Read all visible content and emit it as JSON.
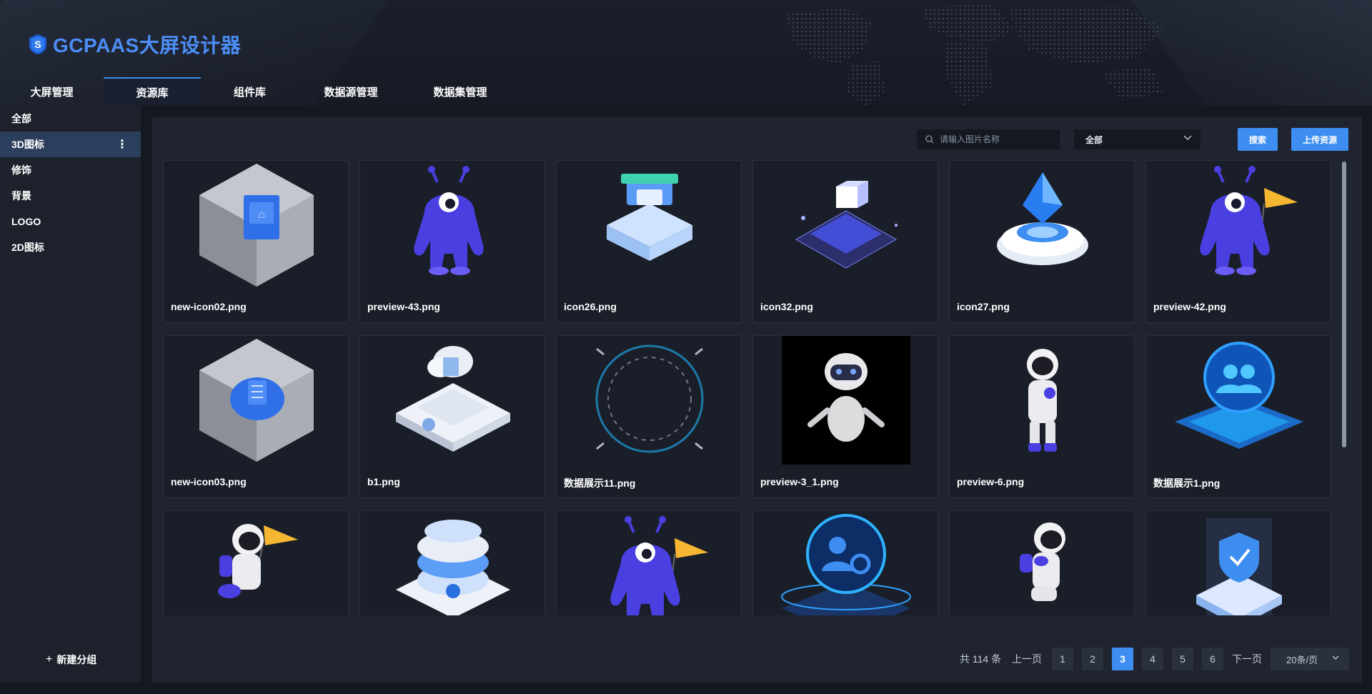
{
  "app": {
    "title": "GCPAAS大屏设计器"
  },
  "nav": {
    "tabs": [
      {
        "label": "大屏管理"
      },
      {
        "label": "资源库"
      },
      {
        "label": "组件库"
      },
      {
        "label": "数据源管理"
      },
      {
        "label": "数据集管理"
      }
    ],
    "active_tab": "资源库"
  },
  "sidebar": {
    "items": [
      {
        "label": "全部"
      },
      {
        "label": "3D图标"
      },
      {
        "label": "修饰"
      },
      {
        "label": "背景"
      },
      {
        "label": "LOGO"
      },
      {
        "label": "2D图标"
      }
    ],
    "active_item": "3D图标",
    "more_icon": "more-vertical-icon",
    "new_group_label": "新建分组"
  },
  "toolbar": {
    "search_placeholder": "请输入图片名称",
    "search_value": "",
    "type_select_value": "全部",
    "search_button_label": "搜索",
    "upload_button_label": "上传资源"
  },
  "resources": [
    {
      "name": "new-icon02.png",
      "icon": "3d-glass-cube-building-icon"
    },
    {
      "name": "preview-43.png",
      "icon": "purple-alien-mascot-icon"
    },
    {
      "name": "icon26.png",
      "icon": "3d-shop-store-icon"
    },
    {
      "name": "icon32.png",
      "icon": "3d-platform-cube-icon"
    },
    {
      "name": "icon27.png",
      "icon": "3d-crystal-pedestal-icon"
    },
    {
      "name": "preview-42.png",
      "icon": "purple-alien-flag-icon"
    },
    {
      "name": "new-icon03.png",
      "icon": "3d-glass-cube-cloud-icon"
    },
    {
      "name": "b1.png",
      "icon": "3d-cloud-server-icon"
    },
    {
      "name": "数据展示11.png",
      "icon": "glowing-ring-frame-icon"
    },
    {
      "name": "preview-3_1.png",
      "icon": "white-robot-icon"
    },
    {
      "name": "preview-6.png",
      "icon": "astronaut-standing-icon"
    },
    {
      "name": "数据展示1.png",
      "icon": "users-hologram-platform-icon"
    },
    {
      "name": "",
      "icon": "astronaut-flag-icon"
    },
    {
      "name": "",
      "icon": "3d-database-stack-icon"
    },
    {
      "name": "",
      "icon": "purple-alien-flag-icon"
    },
    {
      "name": "",
      "icon": "user-settings-hologram-icon"
    },
    {
      "name": "",
      "icon": "astronaut-kneeling-icon"
    },
    {
      "name": "",
      "icon": "shield-check-platform-icon"
    }
  ],
  "pagination": {
    "total_text": "共 114 条",
    "prev_label": "上一页",
    "next_label": "下一页",
    "pages": [
      "1",
      "2",
      "3",
      "4",
      "5",
      "6"
    ],
    "current_page": "3",
    "page_size_label": "20条/页"
  },
  "colors": {
    "accent": "#3d8ef0",
    "brand_title": "#4c8ef7",
    "background": "#141821",
    "panel": "#1f2430",
    "sidebar_active": "#2b3e5b"
  }
}
